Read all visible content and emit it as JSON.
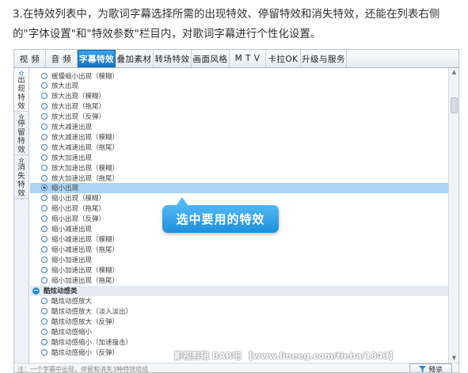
{
  "intro": {
    "text": "3.在特效列表中，为歌词字幕选择所需的出现特效、停留特效和消失特效，还能在列表右侧的\"字体设置\"和\"特效参数\"栏目内，对歌词字幕进行个性化设置。"
  },
  "tabs": [
    "视 频",
    "音 频",
    "字幕特效",
    "叠加素材",
    "转场特效",
    "画面风格",
    "M T V",
    "卡拉OK",
    "升级与服务"
  ],
  "active_tab": "字幕特效",
  "sidebar": {
    "tabs": [
      {
        "label": "出现特效",
        "icon": "star-icon"
      },
      {
        "label": "停留特效",
        "icon": "star-icon"
      },
      {
        "label": "消失特效",
        "icon": "star-icon"
      }
    ]
  },
  "list": {
    "items": [
      "缓慢缩小出现（模糊）",
      "放大出现",
      "放大出现（模糊）",
      "放大出现（拖尾）",
      "放大出现（反弹）",
      "放大减速出现",
      "放大减速出现（模糊）",
      "放大减速出现（拖尾）",
      "放大加速出现",
      "放大加速出现（模糊）",
      "放大加速出现（拖尾）",
      "缩小出现",
      "缩小出现（模糊）",
      "缩小出现（拖尾）",
      "缩小出现（反弹）",
      "缩小减速出现",
      "缩小减速出现（模糊）",
      "缩小减速出现（拖尾）",
      "缩小加速出现",
      "缩小加速出现（模糊）",
      "缩小加速出现（拖尾）"
    ],
    "selected": "缩小出现",
    "category": "酷炫动感类",
    "category_items": [
      "酷炫动感放大",
      "酷炫动感放大（淡入淡出）",
      "酷炫动感放大（反弹）",
      "酷炫动感缩小",
      "酷炫动感缩小（加速撞击）",
      "酷炫动感缩小（反弹）"
    ]
  },
  "callout": {
    "text": "选中要用的特效"
  },
  "bottom": {
    "note": "注：一个字幕中出现，停留和消失3种特效组成",
    "preview_label": "预览"
  },
  "watermark": "影视剪辑 BAR吧 【www.lineeg.com/tieba/1843】",
  "colors": {
    "accent": "#1f8fdc",
    "selected_row": "#a9d3f3",
    "active_tab": "#1576c9"
  }
}
